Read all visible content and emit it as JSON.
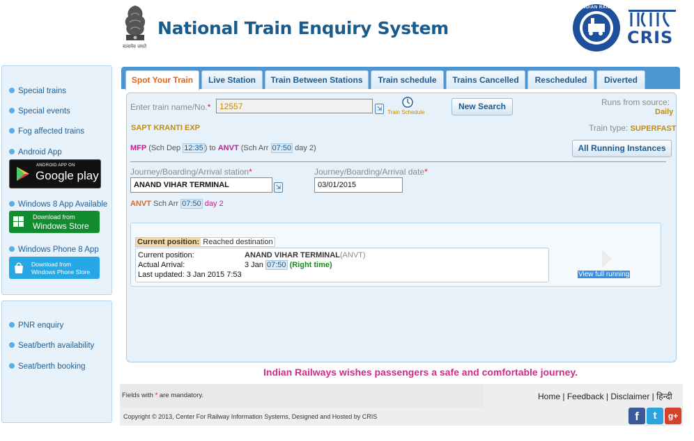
{
  "header": {
    "title": "National Train Enquiry System",
    "emblem_caption": "सत्यमेव जयते",
    "ir_logo_text": "INDIAN RAILWAYS",
    "cris_logo_text": "CRIS"
  },
  "sidebar": {
    "top_links": [
      "Special trains",
      "Special events",
      "Fog affected trains",
      "Android App"
    ],
    "google_play": {
      "small": "ANDROID APP ON",
      "big": "Google play"
    },
    "win8_label": "Windows 8 App Available",
    "windows_store": {
      "small": "Download from",
      "big": "Windows Store"
    },
    "winphone_label": "Windows Phone 8 App",
    "windows_phone_store": {
      "small": "Download from",
      "big": "Windows Phone Store"
    },
    "bottom_links": [
      "PNR enquiry",
      "Seat/berth availability",
      "Seat/berth booking"
    ]
  },
  "tabs": [
    {
      "label": "Spot Your Train",
      "active": true
    },
    {
      "label": "Live Station"
    },
    {
      "label": "Train Between Stations"
    },
    {
      "label": "Train schedule"
    },
    {
      "label": "Trains Cancelled"
    },
    {
      "label": "Rescheduled"
    },
    {
      "label": "Diverted"
    }
  ],
  "form": {
    "train_label": "Enter train name/No.",
    "required_mark": "*",
    "train_value": "12557",
    "train_schedule_link": "Train Schedule",
    "new_search": "New Search",
    "runs_from_label": "Runs from source:",
    "runs_from_value": "Daily",
    "train_name": "SAPT KRANTI EXP",
    "train_type_label": "Train type:",
    "train_type_value": "SUPERFAST",
    "route": {
      "from": "MFP",
      "dep_label": "(Sch Dep",
      "dep_time": "12:35",
      "to_word": ") to",
      "to": "ANVT",
      "arr_label": "(Sch Arr",
      "arr_time": "07:50",
      "day": "day 2)"
    },
    "all_running": "All Running Instances",
    "station_label": "Journey/Boarding/Arrival station",
    "station_value": "ANAND VIHAR TERMINAL",
    "date_label": "Journey/Boarding/Arrival date",
    "date_value": "03/01/2015",
    "arrival": {
      "code": "ANVT",
      "label": "Sch Arr",
      "time": "07:50",
      "day": "day 2"
    }
  },
  "result": {
    "status_label": "Current position:",
    "status_value": "Reached destination",
    "current_position_label": "Current position:",
    "current_position_value": "ANAND VIHAR TERMINAL",
    "current_position_code": "(ANVT)",
    "actual_arrival_label": "Actual Arrival:",
    "actual_arrival_date": "3 Jan",
    "actual_arrival_time": "07:50",
    "actual_arrival_status": "(Right time)",
    "last_updated": "Last updated: 3 Jan 2015 7:53",
    "view_full": "View full running"
  },
  "wish": "Indian Railways wishes passengers a safe and comfortable journey.",
  "footer": {
    "mandatory_pre": "Fields with",
    "mandatory_star": "*",
    "mandatory_post": "are mandatory.",
    "links": [
      "Home",
      "Feedback",
      "Disclaimer",
      "हिन्दी"
    ],
    "copyright": "Copyright © 2013, Center For Railway Information Systems, Designed and Hosted by CRIS",
    "social": [
      "f",
      "t",
      "g+"
    ]
  },
  "colors": {
    "title": "#1a5b8c",
    "tab_bar": "#4b96d2",
    "active_tab_text": "#e0651a",
    "purple": "#c3208d",
    "sidebar_bg": "#e8f2fb"
  }
}
